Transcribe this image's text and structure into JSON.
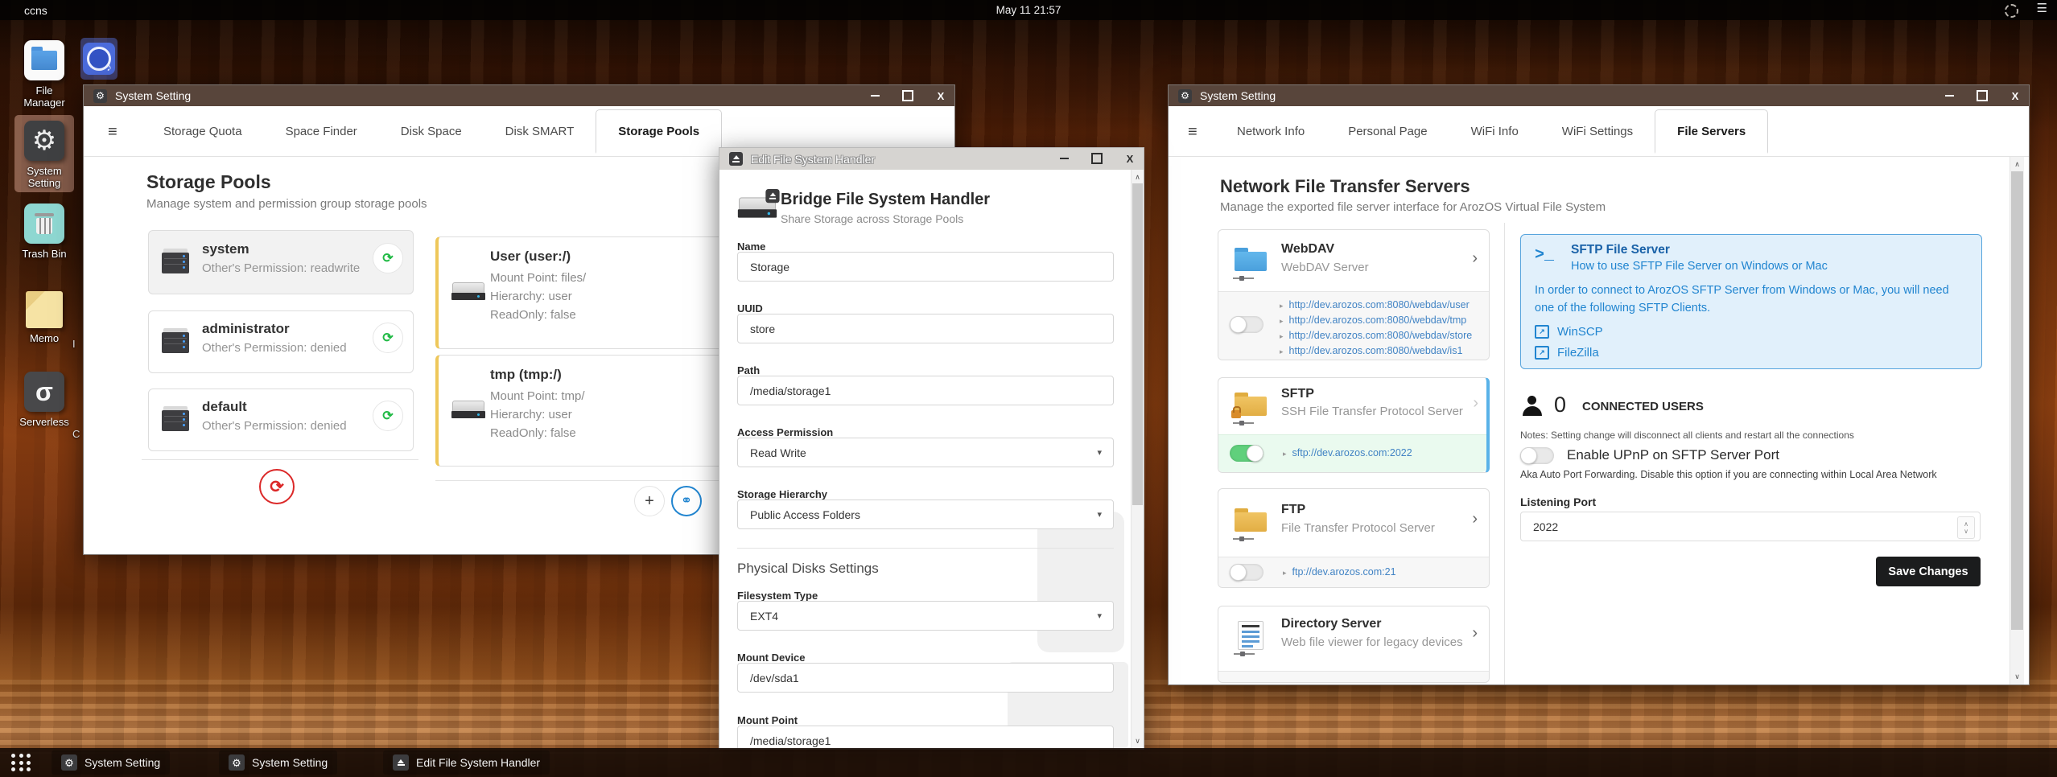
{
  "topbar": {
    "host": "ccns",
    "clock": "May 11 21:57"
  },
  "icons": {
    "gear": "⚙",
    "menu": "☰",
    "hamburger": "≡",
    "refresh": "⟳",
    "chevron_right": "›",
    "bullet_arrow": "▸",
    "external_link": "↗",
    "chain": "⚭",
    "plus": "+",
    "dropdown_caret": "▾",
    "scroll_up": "∧",
    "scroll_down": "∨",
    "music_note": "♪",
    "sigma": "σ",
    "terminal_prompt": ">_",
    "minimize": "−",
    "close": "X"
  },
  "colors": {
    "accent_blue": "#2185d0",
    "link_blue": "#4183c4",
    "green": "#21ba45",
    "toggle_on": "#60d07c",
    "red": "#db2828",
    "yellow_accent": "#eec75a",
    "info_bg": "#e1f0fb",
    "info_border": "#58a5dd",
    "save_button_bg": "#1b1c1d",
    "titlebar_dark": "rgba(46,23,10,0.8)"
  },
  "desktop_icons": [
    {
      "label": "File Manager"
    },
    {
      "label": "System Setting"
    },
    {
      "label": "Trash Bin"
    },
    {
      "label": "Memo"
    },
    {
      "label": "Serverless"
    }
  ],
  "desktop_fragments": {
    "row_memo": "I",
    "row_serverless": "C"
  },
  "storage_window": {
    "title": "System Setting",
    "tabs": [
      {
        "label": "Storage Quota"
      },
      {
        "label": "Space Finder"
      },
      {
        "label": "Disk Space"
      },
      {
        "label": "Disk SMART"
      },
      {
        "label": "Storage Pools"
      }
    ],
    "heading": "Storage Pools",
    "subheading": "Manage system and permission group storage pools",
    "pools": [
      {
        "name": "system",
        "permission": "Other's Permission: readwrite"
      },
      {
        "name": "administrator",
        "permission": "Other's Permission: denied"
      },
      {
        "name": "default",
        "permission": "Other's Permission: denied"
      }
    ],
    "mounts": [
      {
        "name": "User (user:/)",
        "mount_point": "Mount Point: files/",
        "hierarchy": "Hierarchy: user",
        "readonly": "ReadOnly: false"
      },
      {
        "name": "tmp (tmp:/)",
        "mount_point": "Mount Point: tmp/",
        "hierarchy": "Hierarchy: user",
        "readonly": "ReadOnly: false"
      }
    ]
  },
  "edit_window": {
    "title": "Edit File System Handler",
    "heading": "Bridge File System Handler",
    "subheading": "Share Storage across Storage Pools",
    "name_label": "Name",
    "name_value": "Storage",
    "uuid_label": "UUID",
    "uuid_value": "store",
    "path_label": "Path",
    "path_value": "/media/storage1",
    "access_label": "Access Permission",
    "access_value": "Read Write",
    "hierarchy_label": "Storage Hierarchy",
    "hierarchy_value": "Public Access Folders",
    "section_label": "Physical Disks Settings",
    "fstype_label": "Filesystem Type",
    "fstype_value": "EXT4",
    "mount_device_label": "Mount Device",
    "mount_device_value": "/dev/sda1",
    "mount_point_label": "Mount Point",
    "mount_point_value": "/media/storage1"
  },
  "network_window": {
    "title": "System Setting",
    "tabs": [
      {
        "label": "Network Info"
      },
      {
        "label": "Personal Page"
      },
      {
        "label": "WiFi Info"
      },
      {
        "label": "WiFi Settings"
      },
      {
        "label": "File Servers"
      }
    ],
    "heading": "Network File Transfer Servers",
    "subheading": "Manage the exported file server interface for ArozOS Virtual File System",
    "webdav": {
      "name": "WebDAV",
      "desc": "WebDAV Server",
      "links": [
        {
          "url": "http://dev.arozos.com:8080/webdav/user"
        },
        {
          "url": "http://dev.arozos.com:8080/webdav/tmp"
        },
        {
          "url": "http://dev.arozos.com:8080/webdav/store"
        },
        {
          "url": "http://dev.arozos.com:8080/webdav/is1"
        }
      ]
    },
    "sftp": {
      "name": "SFTP",
      "desc": "SSH File Transfer Protocol Server",
      "link": "sftp://dev.arozos.com:2022"
    },
    "ftp": {
      "name": "FTP",
      "desc": "File Transfer Protocol Server",
      "link": "ftp://dev.arozos.com:21"
    },
    "directory": {
      "name": "Directory Server",
      "desc": "Web file viewer for legacy devices"
    },
    "sftp_help": {
      "title": "SFTP File Server",
      "subtitle": "How to use SFTP File Server on Windows or Mac",
      "body": "In order to connect to ArozOS SFTP Server from Windows or Mac, you will need one of the following SFTP Clients.",
      "clients": [
        {
          "label": "WinSCP"
        },
        {
          "label": "FileZilla"
        }
      ]
    },
    "connected_users": {
      "count": "0",
      "label": "CONNECTED USERS"
    },
    "notes": "Notes: Setting change will disconnect all clients and restart all the connections",
    "upnp_label": "Enable UPnP on SFTP Server Port",
    "upnp_desc": "Aka Auto Port Forwarding. Disable this option if you are connecting within Local Area Network",
    "listening_port_label": "Listening Port",
    "listening_port_value": "2022",
    "save_button": "Save Changes"
  },
  "taskbar": {
    "items": [
      {
        "label": "System Setting"
      },
      {
        "label": "System Setting"
      },
      {
        "label": "Edit File System Handler"
      }
    ]
  }
}
